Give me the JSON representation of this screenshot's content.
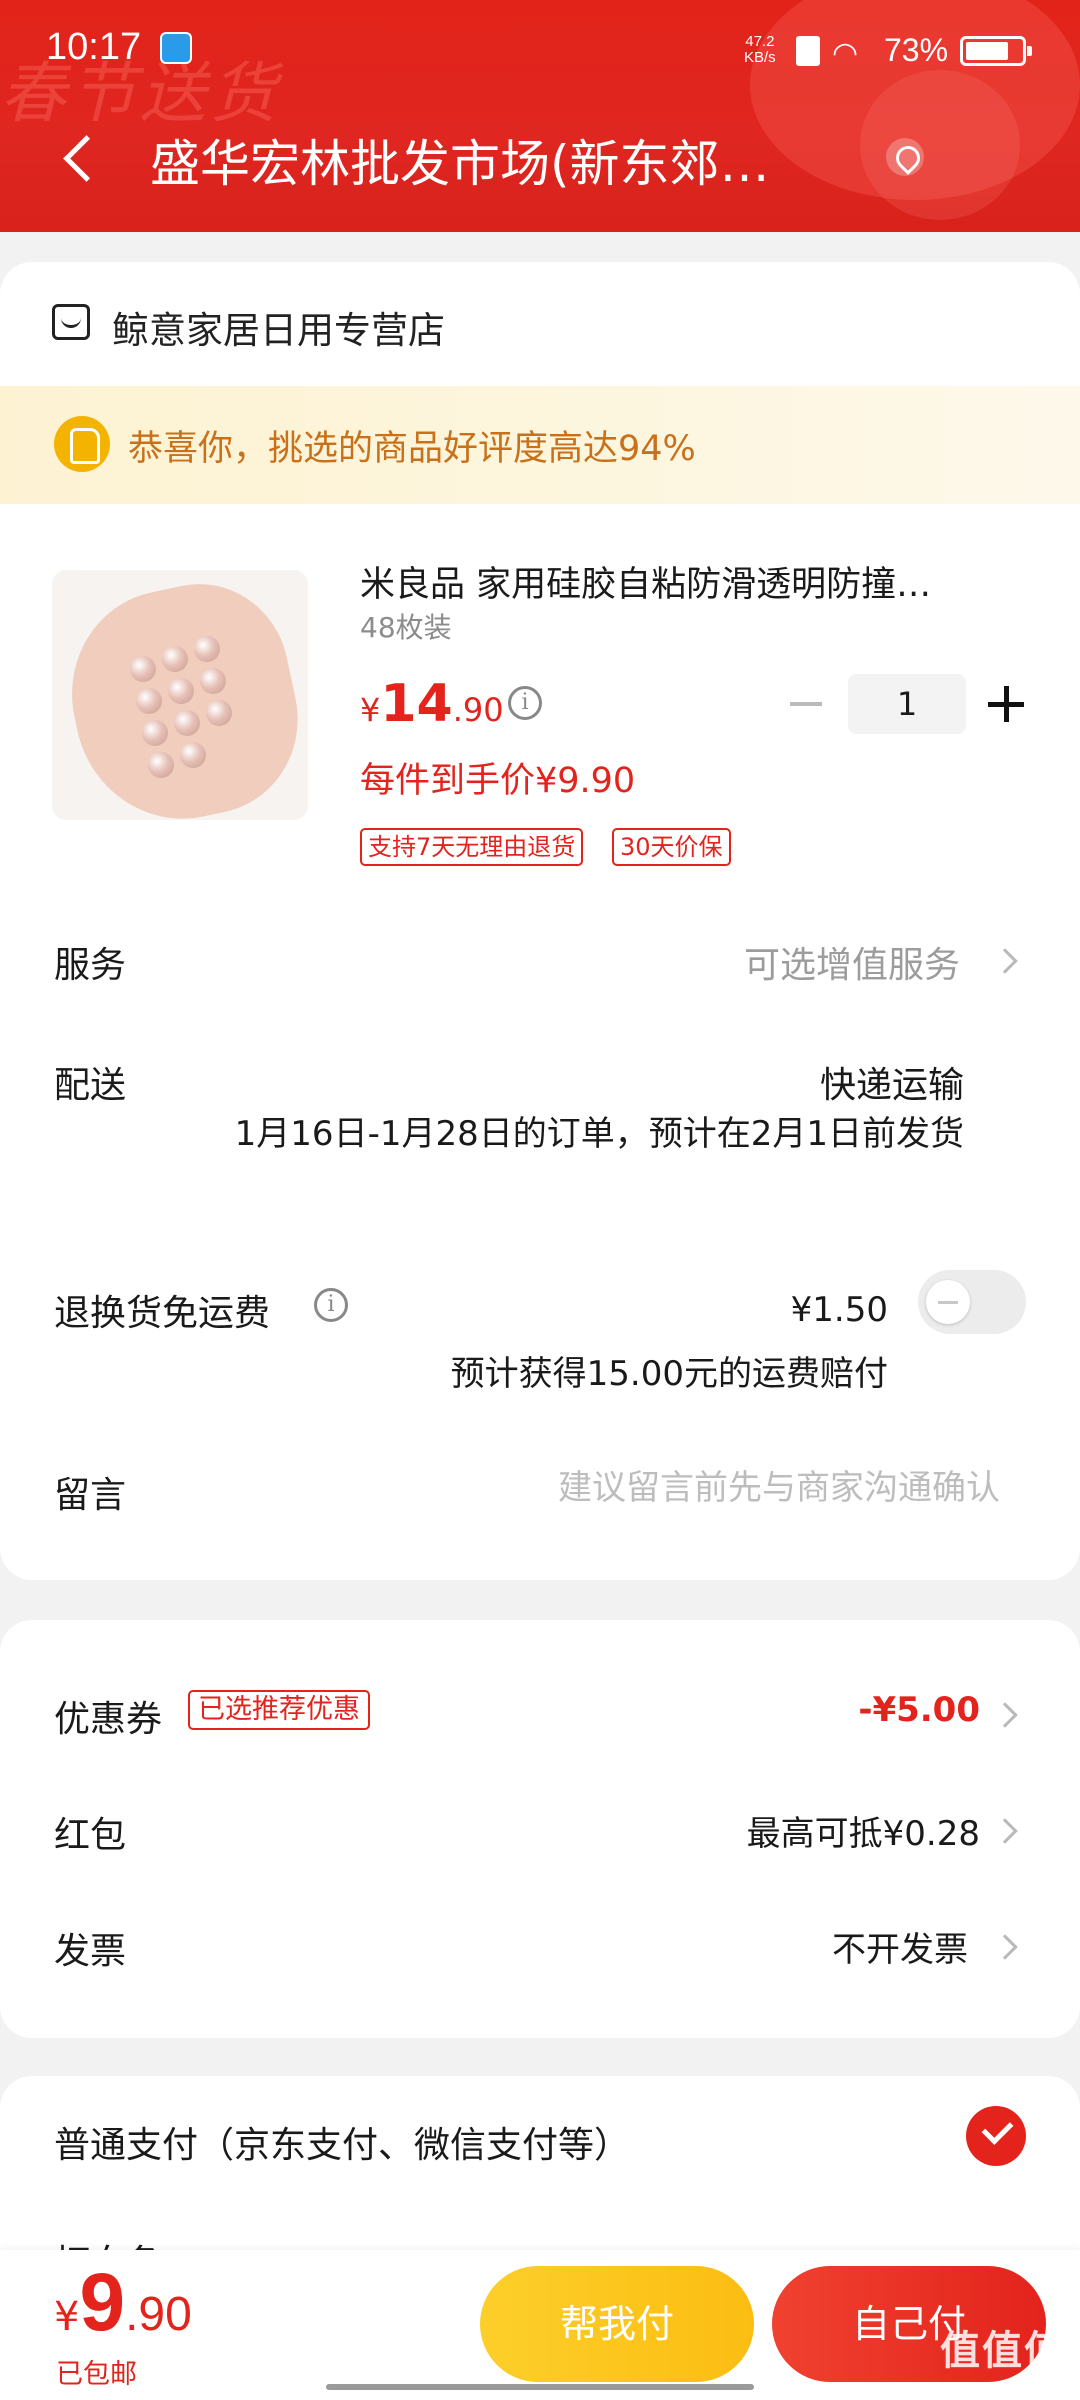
{
  "status_bar": {
    "time": "10:17",
    "net_speed_value": "47.2",
    "net_speed_unit": "KB/s",
    "battery": "73%"
  },
  "header": {
    "festive_text": "春节送货",
    "title": "盛华宏林批发市场(新东郊…"
  },
  "store": {
    "name": "鲸意家居日用专营店"
  },
  "praise_banner": {
    "text": "恭喜你，挑选的商品好评度高达94%"
  },
  "product": {
    "title": "米良品 家用硅胶自粘防滑透明防撞…",
    "spec": "48枚装",
    "price_currency": "¥",
    "price_integer": "14",
    "price_decimal": ".90",
    "quantity": "1",
    "unit_price": "每件到手价¥9.90",
    "tags": [
      "支持7天无理由退货",
      "30天价保"
    ]
  },
  "service": {
    "label": "服务",
    "value": "可选增值服务"
  },
  "delivery": {
    "label": "配送",
    "method": "快递运输",
    "note": "1月16日-1月28日的订单，预计在2月1日前发货"
  },
  "return_shipping": {
    "label": "退换货免运费",
    "price": "¥1.50",
    "compensation": "预计获得15.00元的运费赔付",
    "enabled": false
  },
  "note": {
    "label": "留言",
    "placeholder": "建议留言前先与商家沟通确认"
  },
  "coupon": {
    "label": "优惠券",
    "badge": "已选推荐优惠",
    "value": "-¥5.00"
  },
  "red_packet": {
    "label": "红包",
    "value": "最高可抵¥0.28"
  },
  "invoice": {
    "label": "发票",
    "value": "不开发票"
  },
  "payment": {
    "label": "普通支付（京东支付、微信支付等）",
    "second_label": "打白条",
    "selected": true
  },
  "bottom": {
    "total_currency": "¥",
    "total_integer": "9",
    "total_decimal": ".90",
    "shipping": "已包邮",
    "friend_pay": "帮我付",
    "self_pay": "自己付"
  },
  "watermark": "值值值",
  "colors": {
    "brand_red": "#e3231c",
    "accent_yellow": "#fbbd12",
    "praise_orange": "#c9711a"
  },
  "icons": [
    "app-notification-icon",
    "sim-icon",
    "wifi-icon",
    "battery-icon",
    "back-icon",
    "location-icon",
    "store-icon",
    "thumbs-up-icon",
    "info-icon",
    "minus-icon",
    "plus-icon",
    "chevron-right-icon",
    "check-icon"
  ]
}
